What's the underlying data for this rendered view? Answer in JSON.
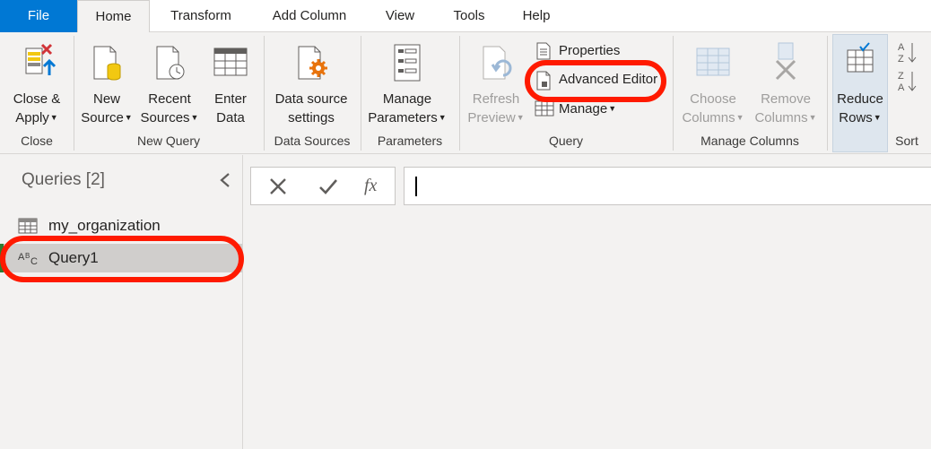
{
  "tabs": [
    {
      "label": "File"
    },
    {
      "label": "Home"
    },
    {
      "label": "Transform"
    },
    {
      "label": "Add Column"
    },
    {
      "label": "View"
    },
    {
      "label": "Tools"
    },
    {
      "label": "Help"
    }
  ],
  "ribbon": {
    "groups": {
      "close": "Close",
      "new_query": "New Query",
      "data_sources": "Data Sources",
      "parameters": "Parameters",
      "query": "Query",
      "manage_columns": "Manage Columns",
      "sort": "Sort"
    },
    "close_apply": {
      "line1": "Close &",
      "line2": "Apply"
    },
    "new_source": {
      "line1": "New",
      "line2": "Source"
    },
    "recent_sources": {
      "line1": "Recent",
      "line2": "Sources"
    },
    "enter_data": {
      "line1": "Enter",
      "line2": "Data"
    },
    "data_source_settings": {
      "line1": "Data source",
      "line2": "settings"
    },
    "manage_parameters": {
      "line1": "Manage",
      "line2": "Parameters"
    },
    "refresh_preview": {
      "line1": "Refresh",
      "line2": "Preview"
    },
    "properties": "Properties",
    "advanced_editor": "Advanced Editor",
    "manage": "Manage",
    "choose_columns": {
      "line1": "Choose",
      "line2": "Columns"
    },
    "remove_columns": {
      "line1": "Remove",
      "line2": "Columns"
    },
    "reduce_rows": {
      "line1": "Reduce",
      "line2": "Rows"
    }
  },
  "queries_pane": {
    "title": "Queries [2]",
    "items": [
      {
        "label": "my_organization",
        "icon": "table-icon"
      },
      {
        "label": "Query1",
        "icon": "text-type-icon",
        "selected": true
      }
    ]
  },
  "formula_bar": {
    "fx_label": "fx",
    "value": ""
  },
  "colors": {
    "accent": "#0078d4",
    "highlight": "#ff1a00",
    "background": "#f3f2f1"
  }
}
